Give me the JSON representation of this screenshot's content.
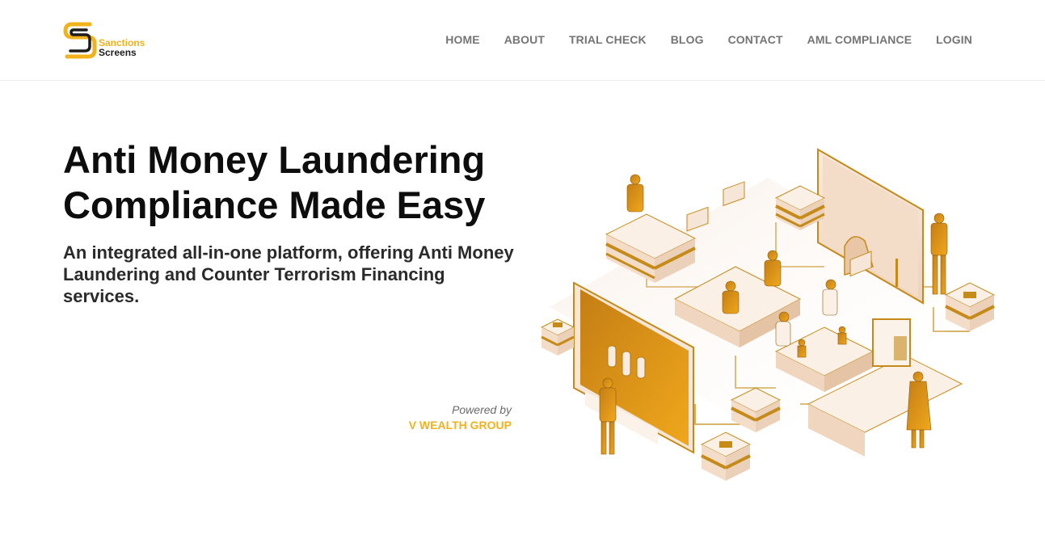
{
  "brand": {
    "line1": "Sanctions",
    "line2": "Screens"
  },
  "nav": {
    "home": "HOME",
    "about": "ABOUT",
    "trial_check": "TRIAL CHECK",
    "blog": "BLOG",
    "contact": "CONTACT",
    "aml_compliance": "AML COMPLIANCE",
    "login": "LOGIN"
  },
  "hero": {
    "title_line1": "Anti Money Laundering",
    "title_line2": "Compliance Made Easy",
    "subtitle": "An integrated all-in-one platform, offering Anti Money Laundering and Counter Terrorism Financing services."
  },
  "powered": {
    "label": "Powered by",
    "company": "V WEALTH GROUP"
  },
  "colors": {
    "accent": "#f2b21b",
    "dark_accent": "#c58a17",
    "text": "#0d0d0d",
    "nav": "#757575"
  }
}
